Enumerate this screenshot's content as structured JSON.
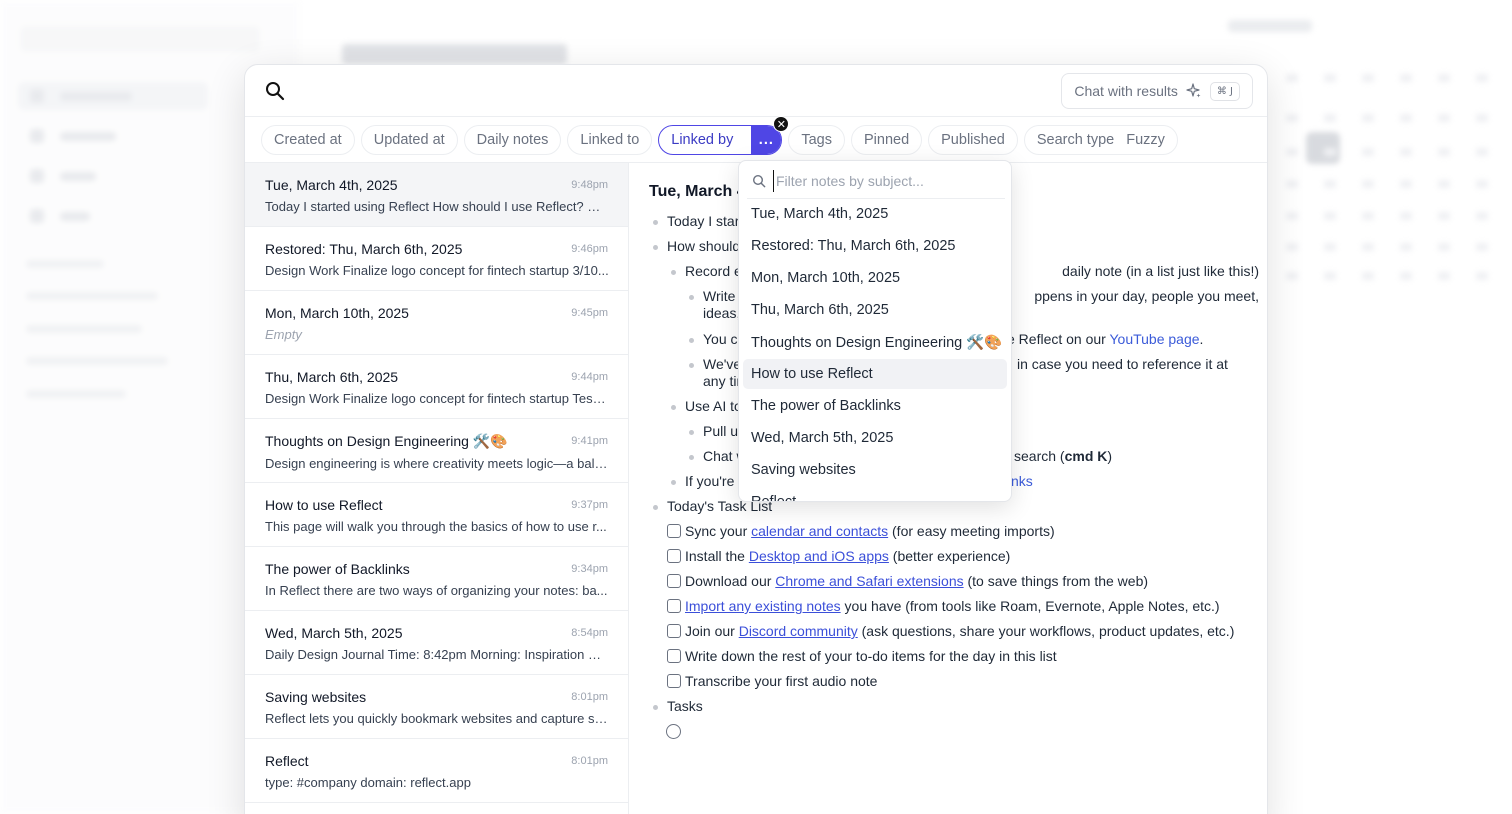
{
  "search": {
    "placeholder": "",
    "chat_label": "Chat with results",
    "chat_shortcut": "⌘ J"
  },
  "filters": [
    {
      "label": "Created at"
    },
    {
      "label": "Updated at"
    },
    {
      "label": "Daily notes"
    },
    {
      "label": "Linked to"
    },
    {
      "label": "Linked by",
      "active": true,
      "value": "..."
    },
    {
      "label": "Tags"
    },
    {
      "label": "Pinned"
    },
    {
      "label": "Published"
    },
    {
      "label": "Search type",
      "value": "Fuzzy"
    }
  ],
  "results": [
    {
      "title": "Tue, March 4th, 2025",
      "time": "9:48pm",
      "snippet": "Today I started using Reflect How should I use Reflect? Re..."
    },
    {
      "title": "Restored: Thu, March 6th, 2025",
      "time": "9:46pm",
      "snippet": "Design Work Finalize logo concept for fintech startup 3/10..."
    },
    {
      "title": "Mon, March 10th, 2025",
      "time": "9:45pm",
      "snippet": "Empty"
    },
    {
      "title": "Thu, March 6th, 2025",
      "time": "9:44pm",
      "snippet": "Design Work Finalize logo concept for fintech startup Test ..."
    },
    {
      "title": "Thoughts on Design Engineering 🛠️🎨",
      "time": "9:41pm",
      "snippet": "Design engineering is where creativity meets logic—a bala..."
    },
    {
      "title": "How to use Reflect",
      "time": "9:37pm",
      "snippet": "This page will walk you through the basics of how to use r..."
    },
    {
      "title": "The power of Backlinks",
      "time": "9:34pm",
      "snippet": "In Reflect there are two ways of organizing your notes: ba..."
    },
    {
      "title": "Wed, March 5th, 2025",
      "time": "8:54pm",
      "snippet": "Daily Design Journal Time: 8:42pm Morning: Inspiration & I..."
    },
    {
      "title": "Saving websites",
      "time": "8:01pm",
      "snippet": "Reflect lets you quickly bookmark websites and capture sn..."
    },
    {
      "title": "Reflect",
      "time": "8:01pm",
      "snippet": "type: #company domain: reflect.app"
    }
  ],
  "preview": {
    "title": "Tue, March 4",
    "lines": {
      "l1": "Today I star",
      "l2": "How should",
      "l3a": "Record e",
      "l3b": "daily note (in a list just like this!)",
      "l4a": "Write",
      "l4b": "ppens in your day, people you meet,",
      "l4c": "ideas,",
      "l5a": "You ca",
      "l5b": "e Reflect on our ",
      "l5link": "YouTube page",
      "l5c": ".",
      "l6a": "We've",
      "l6b": "in case you need to reference it at",
      "l6c": "any tir",
      "l7": "Use AI to",
      "l8": "Pull up",
      "l9a": "Chat w",
      "l9b": "search (",
      "l9bold": "cmd K",
      "l9c": ")",
      "l10a": "If you're",
      "l10link": "nks",
      "task_heading": "Today's Task List",
      "tasks_heading": "Tasks"
    },
    "tasks": [
      {
        "pre": "Sync your ",
        "link": "calendar and contacts",
        "post": " (for easy meeting imports)"
      },
      {
        "pre": "Install the ",
        "link": "Desktop and iOS apps",
        "post": " (better experience)"
      },
      {
        "pre": "Download our ",
        "link": "Chrome and Safari extensions",
        "post": " (to save things from the web)"
      },
      {
        "pre": "",
        "link": "Import any existing notes",
        "post": " you have (from tools like Roam, Evernote, Apple Notes, etc.)"
      },
      {
        "pre": "Join our ",
        "link": "Discord community",
        "post": " (ask questions, share your workflows, product updates, etc.)"
      },
      {
        "pre": "Write down the rest of your to-do items for the day in this list",
        "link": "",
        "post": ""
      },
      {
        "pre": "Transcribe your first audio note",
        "link": "",
        "post": ""
      }
    ]
  },
  "dropdown": {
    "placeholder": "Filter notes by subject...",
    "items": [
      "Tue, March 4th, 2025",
      "Restored: Thu, March 6th, 2025",
      "Mon, March 10th, 2025",
      "Thu, March 6th, 2025",
      "Thoughts on Design Engineering 🛠️🎨",
      "How to use Reflect",
      "The power of Backlinks",
      "Wed, March 5th, 2025",
      "Saving websites",
      "Reflect"
    ],
    "hover_index": 5
  },
  "colors": {
    "accent": "#4f46e5",
    "link": "#3b5bd9"
  }
}
